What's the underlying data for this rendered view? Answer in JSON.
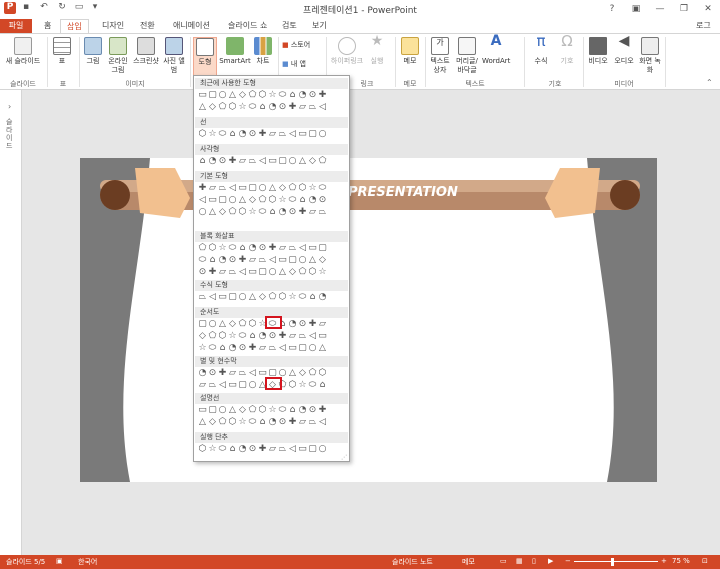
{
  "window": {
    "title": "프레젠테이션1 - PowerPoint",
    "login": "로그인"
  },
  "tabs": [
    "파일",
    "홈",
    "삽입",
    "디자인",
    "전환",
    "애니메이션",
    "슬라이드 쇼",
    "검토",
    "보기"
  ],
  "active_tab": "삽입",
  "ribbon": {
    "buttons": [
      {
        "label": "새 슬라이드",
        "icon": "new-slide-icon"
      },
      {
        "label": "표",
        "icon": "table-icon"
      },
      {
        "label": "그림",
        "icon": "picture-icon"
      },
      {
        "label": "온라인 그림",
        "icon": "online-picture-icon"
      },
      {
        "label": "스크린샷",
        "icon": "screenshot-icon"
      },
      {
        "label": "사진 앨범",
        "icon": "photo-album-icon"
      },
      {
        "label": "도형",
        "icon": "shapes-icon"
      },
      {
        "label": "SmartArt",
        "icon": "smartart-icon"
      },
      {
        "label": "차트",
        "icon": "chart-icon"
      },
      {
        "label": "스토어",
        "icon": "store-icon"
      },
      {
        "label": "내 앱",
        "icon": "my-apps-icon"
      },
      {
        "label": "하이퍼링크",
        "icon": "hyperlink-icon"
      },
      {
        "label": "실행",
        "icon": "action-icon"
      },
      {
        "label": "메모",
        "icon": "comment-icon"
      },
      {
        "label": "텍스트 상자",
        "icon": "textbox-icon"
      },
      {
        "label": "머리글/바닥글",
        "icon": "header-footer-icon"
      },
      {
        "label": "WordArt",
        "icon": "wordart-icon"
      },
      {
        "label": "수식",
        "icon": "equation-icon"
      },
      {
        "label": "기호",
        "icon": "symbol-icon"
      },
      {
        "label": "비디오",
        "icon": "video-icon"
      },
      {
        "label": "오디오",
        "icon": "audio-icon"
      },
      {
        "label": "화면 녹화",
        "icon": "screen-record-icon"
      }
    ],
    "groups": [
      "슬라이드",
      "표",
      "이미지",
      "링크",
      "메모",
      "텍스트",
      "기호",
      "미디어"
    ]
  },
  "dropdown": {
    "sections": [
      "최근에 사용한 도형",
      "선",
      "사각형",
      "기본 도형",
      "블록 화살표",
      "수식 도형",
      "순서도",
      "별 및 현수막",
      "설명선",
      "실행 단추"
    ]
  },
  "slide": {
    "title_text": "PRESENTATION"
  },
  "status": {
    "slide_info": "슬라이드 5/5",
    "language": "한국어",
    "notes": "슬라이드 노트",
    "comments": "메모",
    "zoom": "75 %"
  },
  "colors": {
    "accent": "#d24726",
    "highlight": "#d4141e"
  }
}
